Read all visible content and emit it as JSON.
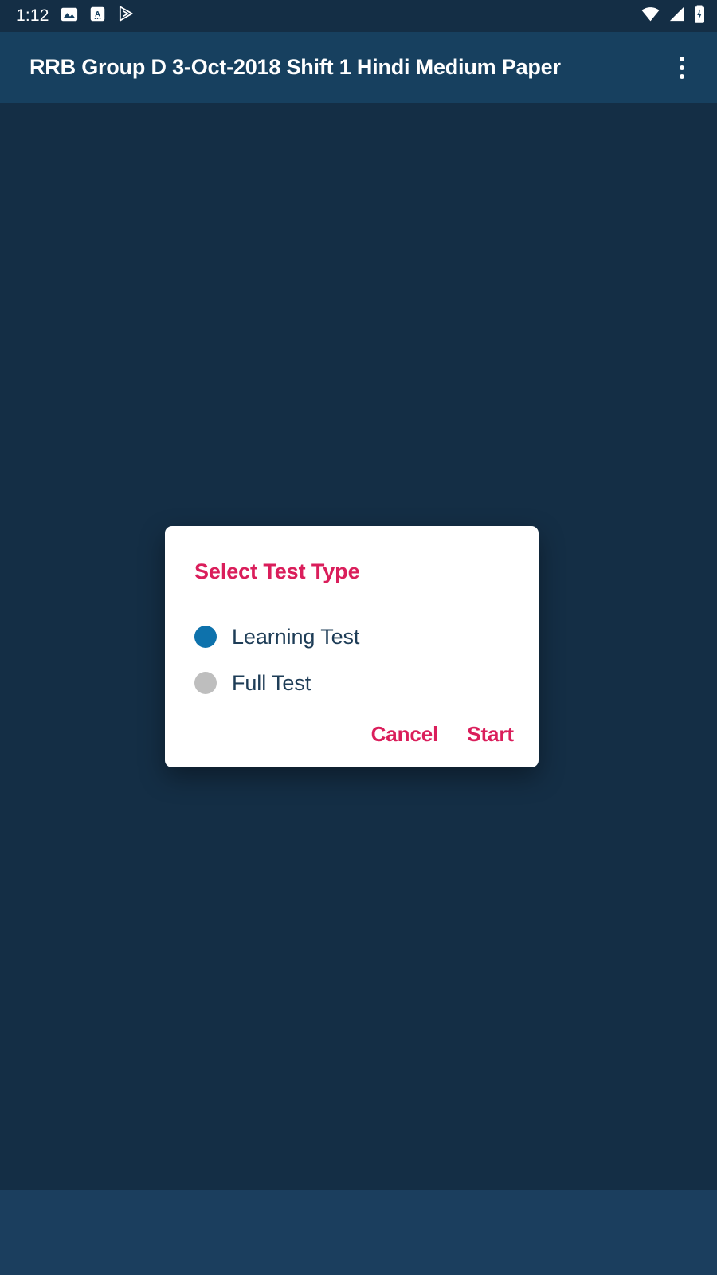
{
  "status_bar": {
    "time": "1:12",
    "left_icons": [
      {
        "name": "image-icon"
      },
      {
        "name": "notification-letter-a-icon"
      },
      {
        "name": "play-store-icon"
      }
    ],
    "right_icons": [
      {
        "name": "wifi-icon"
      },
      {
        "name": "cellular-signal-icon"
      },
      {
        "name": "battery-charging-icon"
      }
    ],
    "background_color": "#142E45"
  },
  "app_bar": {
    "title": "RRB Group D 3-Oct-2018 Shift 1 Hindi Medium Paper",
    "overflow_icon": "more-vert-icon",
    "background_color": "#17405F",
    "text_color": "#FFFFFF"
  },
  "dialog": {
    "title": "Select Test Type",
    "title_color": "#DA1E5B",
    "background_color": "#FFFFFF",
    "options": [
      {
        "label": "Learning Test",
        "selected": true,
        "dot_color": "#0E72AC"
      },
      {
        "label": "Full Test",
        "selected": false,
        "dot_color": "#BEBEBE"
      }
    ],
    "cancel_label": "Cancel",
    "start_label": "Start",
    "button_color": "#DA1E5B"
  },
  "screen": {
    "background_color": "#142E45",
    "nav_bar_color": "#1B3E5E"
  }
}
